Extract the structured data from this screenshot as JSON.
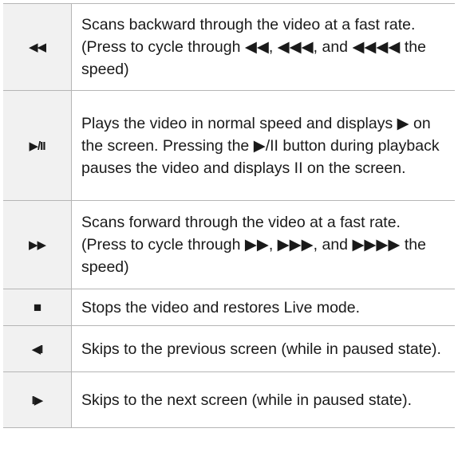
{
  "rows": [
    {
      "icon": "◀◀",
      "icon_name": "rewind-icon",
      "description": "Scans backward through the video at a fast rate. (Press to cycle through ◀◀, ◀◀◀, and ◀◀◀◀ the speed)"
    },
    {
      "icon": "▶/II",
      "icon_name": "play-pause-icon",
      "description": "Plays the video in normal speed and displays ▶ on the screen. Pressing the ▶/II button during playback pauses the video and displays II on the screen."
    },
    {
      "icon": "▶▶",
      "icon_name": "fast-forward-icon",
      "description": "Scans forward through the video at a fast rate. (Press to cycle through ▶▶, ▶▶▶, and ▶▶▶▶ the speed)"
    },
    {
      "icon": "■",
      "icon_name": "stop-icon",
      "description": "Stops the video and restores Live mode."
    },
    {
      "icon": "◀I",
      "icon_name": "step-back-icon",
      "description": "Skips to the previous screen (while in paused state)."
    },
    {
      "icon": "I▶",
      "icon_name": "step-forward-icon",
      "description": "Skips to the next screen (while in paused state)."
    }
  ]
}
